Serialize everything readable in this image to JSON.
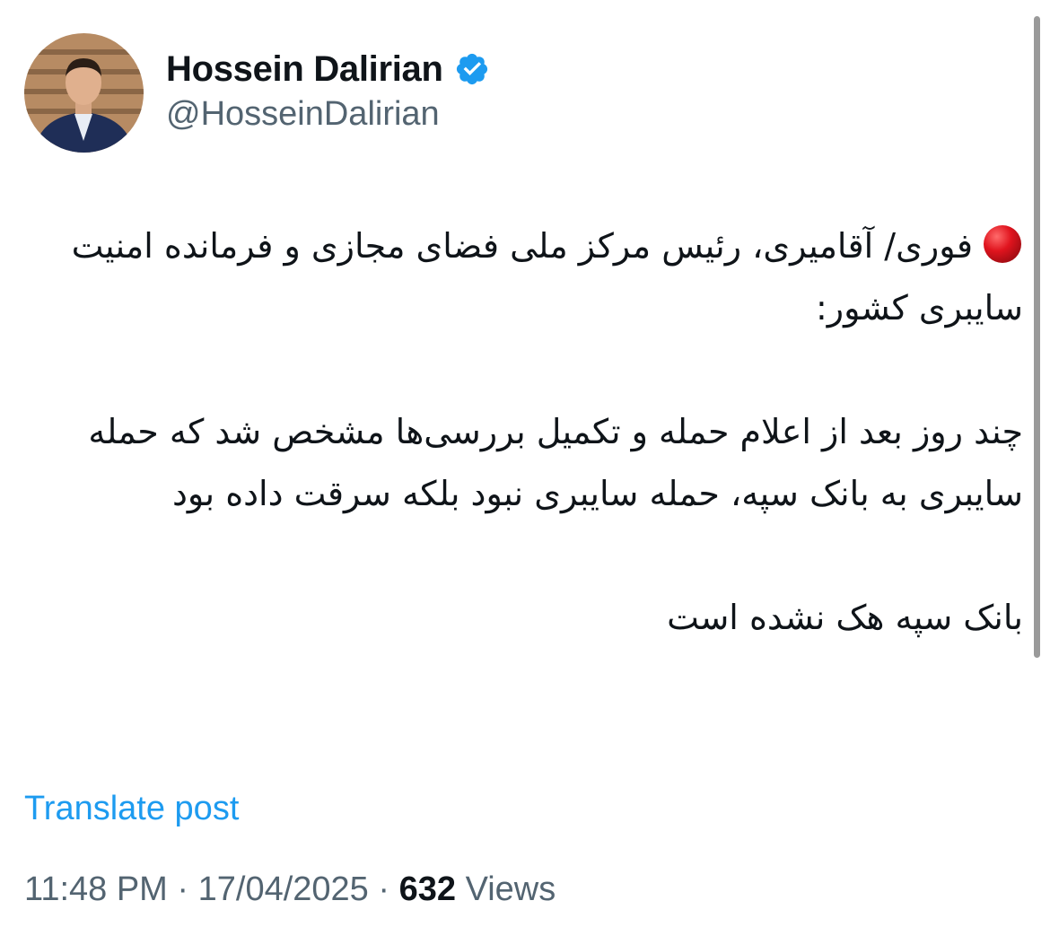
{
  "author": {
    "display_name": "Hossein Dalirian",
    "handle": "@HosseinDalirian",
    "verified": true,
    "avatar_icon": "profile-photo"
  },
  "tweet": {
    "paragraphs": [
      {
        "icon": "red-circle-icon",
        "text": "فوری/ آقامیری، رئیس مرکز ملی فضای مجازی و فرمانده امنیت سایبری کشور:"
      },
      {
        "icon": null,
        "text": "چند روز بعد از اعلام حمله و تکمیل بررسی‌ها مشخص شد که حمله سایبری به بانک سپه، حمله سایبری نبود بلکه سرقت داده بود"
      },
      {
        "icon": null,
        "text": "بانک سپه هک نشده است"
      }
    ]
  },
  "translate_label": "Translate post",
  "meta": {
    "time": "11:48 PM",
    "separator": "·",
    "date": "17/04/2025",
    "views_count": "632",
    "views_label": "Views"
  },
  "colors": {
    "link": "#1d9bf0",
    "secondary_text": "#536471",
    "primary_text": "#0f1419",
    "verified_badge": "#1d9bf0",
    "red_circle": "#d9141e"
  }
}
